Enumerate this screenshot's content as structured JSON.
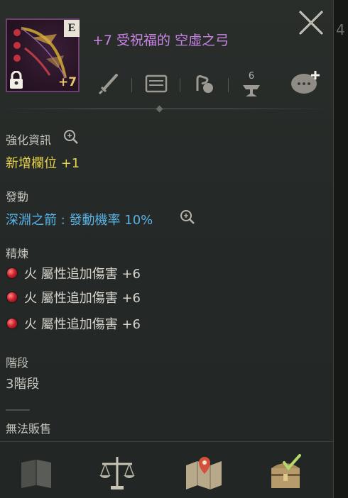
{
  "item": {
    "title": "+7 受祝福的 空虛之弓",
    "grade": "E",
    "enhance_level": "+7",
    "title_color": "#c983e6"
  },
  "toolbar": {
    "icons": [
      "sword-icon",
      "card-icon",
      "hand-bag-icon",
      "anvil-icon",
      "chat-add-icon"
    ],
    "anvil_count": "6"
  },
  "sections": {
    "enhance_info": {
      "label": "強化資訊",
      "value": "新增欄位 +1"
    },
    "activation": {
      "label": "發動",
      "skill_name": "深淵之箭",
      "separator": ":",
      "detail": "發動機率 10%"
    },
    "refine": {
      "label": "精煉",
      "lines": [
        "火 屬性追加傷害 +6",
        "火 屬性追加傷害 +6",
        "火 屬性追加傷害 +6"
      ]
    },
    "tier": {
      "label": "階段",
      "value": "3階段"
    },
    "sell": {
      "value": "無法販售"
    }
  },
  "bottom_bar": {
    "icons": [
      "book-icon",
      "scales-icon",
      "map-icon",
      "chest-icon"
    ]
  },
  "colors": {
    "yellow": "#e7d24b",
    "blue": "#58b3e6",
    "purple": "#c983e6",
    "gold": "#e8c46a"
  },
  "right_edge_glyph": "4"
}
